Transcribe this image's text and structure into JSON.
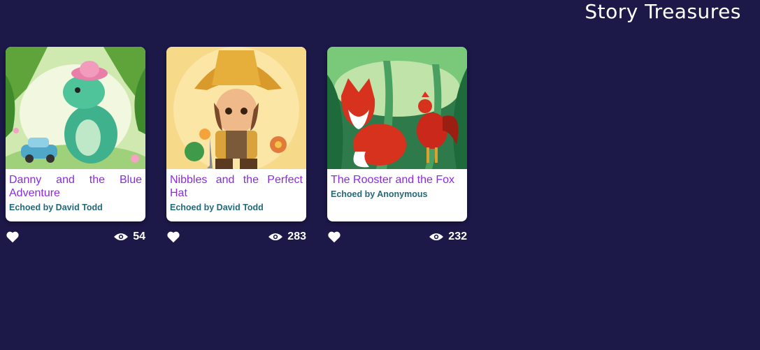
{
  "header": {
    "title": "Story Treasures"
  },
  "stories": [
    {
      "title": "Danny and the Blue Adventure",
      "author": "Echoed by David Todd",
      "views": "54",
      "image": "green dinosaur with pink hat and blue car in jungle"
    },
    {
      "title": "Nibbles and the Perfect Hat",
      "author": "Echoed by David Todd",
      "views": "283",
      "image": "boy with large straw hat and shovel among flowers"
    },
    {
      "title": "The Rooster and the Fox",
      "author": "Echoed by Anonymous",
      "views": "232",
      "image": "red fox and red rooster among jungle leaves"
    }
  ],
  "icons": {
    "like": "heart-icon",
    "views": "eye-icon"
  },
  "colors": {
    "background": "#1c1848",
    "title_link": "#8a2be2",
    "author": "#226a7a"
  }
}
